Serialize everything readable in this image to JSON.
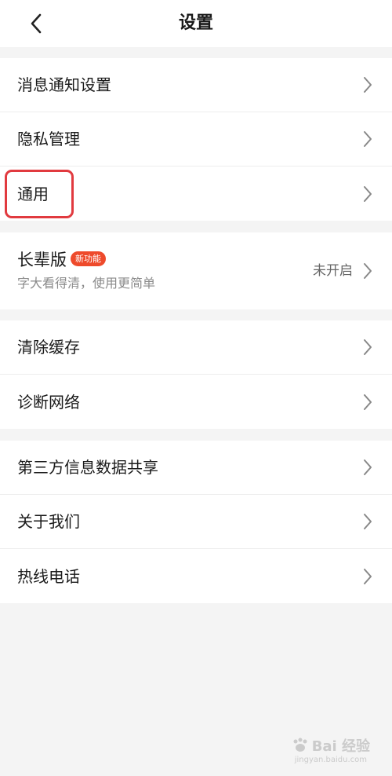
{
  "header": {
    "title": "设置",
    "back_icon": "chevron-left-icon"
  },
  "group1": {
    "items": [
      {
        "label": "消息通知设置"
      },
      {
        "label": "隐私管理"
      },
      {
        "label": "通用"
      }
    ]
  },
  "elder": {
    "title": "长辈版",
    "badge": "新功能",
    "subtitle": "字大看得清，使用更简单",
    "status": "未开启"
  },
  "group3": {
    "items": [
      {
        "label": "清除缓存"
      },
      {
        "label": "诊断网络"
      }
    ]
  },
  "group4": {
    "items": [
      {
        "label": "第三方信息数据共享"
      },
      {
        "label": "关于我们"
      },
      {
        "label": "热线电话"
      }
    ]
  },
  "watermark": {
    "text": "Bai 经验",
    "sub": "jingyan.baidu.com"
  },
  "colors": {
    "highlight": "#e13a3f",
    "badge": "#ee4a2b",
    "background": "#f4f4f4"
  }
}
